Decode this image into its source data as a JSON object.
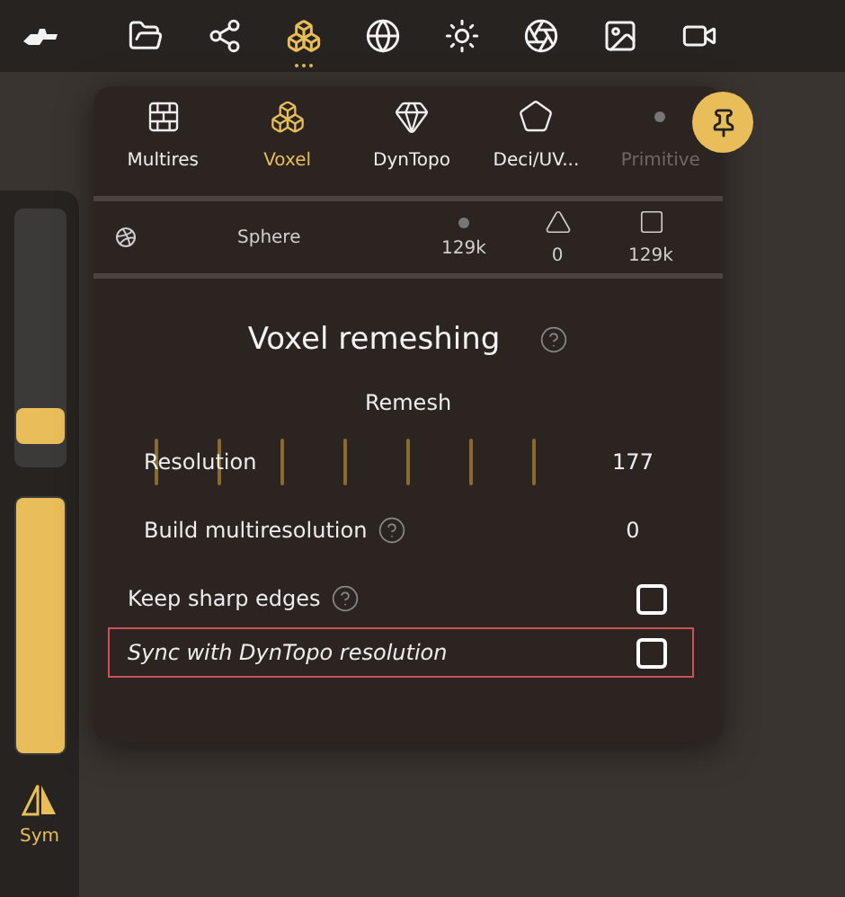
{
  "logo": {
    "kind": "ship"
  },
  "toolbar": [
    {
      "kind": "folder",
      "selected": false
    },
    {
      "kind": "nodes",
      "selected": false
    },
    {
      "kind": "cubes",
      "selected": true
    },
    {
      "kind": "globe",
      "selected": false
    },
    {
      "kind": "sun",
      "selected": false
    },
    {
      "kind": "aperture",
      "selected": false
    },
    {
      "kind": "image",
      "selected": false
    },
    {
      "kind": "camera",
      "selected": false
    }
  ],
  "side_panel": {
    "sliders": [
      {
        "level": 0.1
      },
      {
        "level": 1
      }
    ],
    "sym_label": "Sym"
  },
  "popup": {
    "tabs": [
      {
        "kind": "bricks",
        "label": "Multires",
        "selected": false,
        "disabled": false
      },
      {
        "kind": "cubes",
        "label": "Voxel",
        "selected": true,
        "disabled": false
      },
      {
        "kind": "gem",
        "label": "DynTopo",
        "selected": false,
        "disabled": false
      },
      {
        "kind": "polygon",
        "label": "Deci/UV...",
        "selected": false,
        "disabled": false
      },
      {
        "kind": "dot",
        "label": "Primitive",
        "selected": false,
        "disabled": true
      }
    ],
    "mesh": {
      "name": "Sphere",
      "stats": [
        {
          "kind": "vertex",
          "value": "129k"
        },
        {
          "kind": "triangle",
          "value": "0"
        },
        {
          "kind": "quad",
          "value": "129k"
        }
      ]
    },
    "title": "Voxel remeshing",
    "remesh_button": "Remesh",
    "params": [
      {
        "kind": "slider",
        "label": "Resolution",
        "value": "177",
        "help": false
      },
      {
        "kind": "number",
        "label": "Build multiresolution",
        "value": "0",
        "help": true
      }
    ],
    "options": [
      {
        "label": "Keep sharp edges",
        "help": true,
        "checked": false,
        "highlighted": false
      },
      {
        "label": "Sync with DynTopo resolution",
        "help": false,
        "checked": false,
        "highlighted": true
      }
    ]
  }
}
